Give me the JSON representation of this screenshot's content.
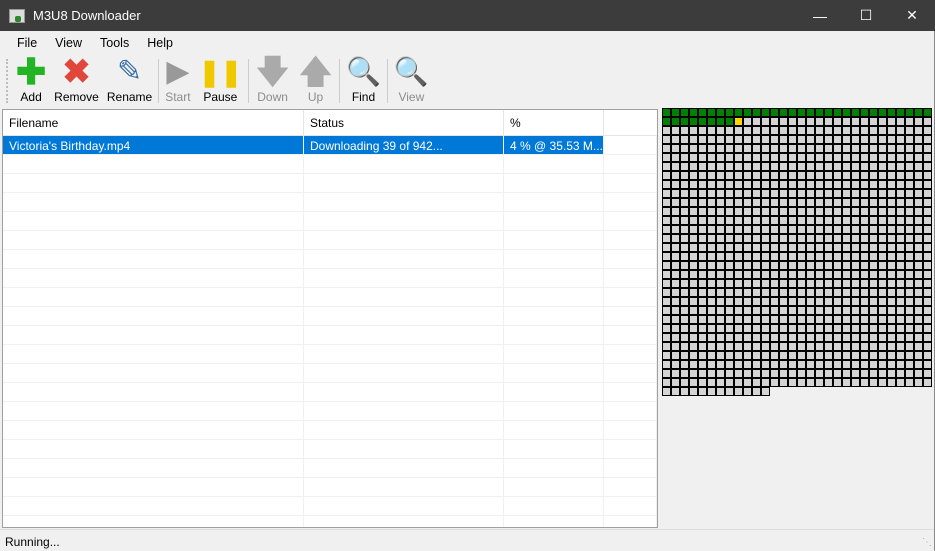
{
  "window": {
    "title": "M3U8 Downloader",
    "icon": "m3u8-app-icon",
    "controls": [
      "minimize",
      "maximize",
      "close"
    ]
  },
  "menu": [
    "File",
    "View",
    "Tools",
    "Help"
  ],
  "toolbar": [
    {
      "label": "Add",
      "icon": "add-icon",
      "enabled": true
    },
    {
      "label": "Remove",
      "icon": "remove-icon",
      "enabled": true
    },
    {
      "label": "Rename",
      "icon": "rename-pencil-icon",
      "enabled": true
    },
    {
      "label": "Start",
      "icon": "play-icon",
      "enabled": false
    },
    {
      "label": "Pause",
      "icon": "pause-icon",
      "enabled": true
    },
    {
      "label": "Down",
      "icon": "arrow-down-icon",
      "enabled": false
    },
    {
      "label": "Up",
      "icon": "arrow-up-icon",
      "enabled": false
    },
    {
      "label": "Find",
      "icon": "find-icon",
      "enabled": true
    },
    {
      "label": "View",
      "icon": "view-icon",
      "enabled": false
    }
  ],
  "list": {
    "columns": [
      "Filename",
      "Status",
      "%"
    ],
    "rows": [
      {
        "filename": "Victoria's Birthday.mp4",
        "status": "Downloading 39 of 942...",
        "percent": "4 % @ 35.53 M...",
        "selected": true
      }
    ]
  },
  "segments": {
    "total": 942,
    "completed": 38,
    "active": 1,
    "colors": {
      "completed": "#008000",
      "active": "#ffd700",
      "pending": "#d4d4d4"
    }
  },
  "statusbar": {
    "text": "Running..."
  }
}
